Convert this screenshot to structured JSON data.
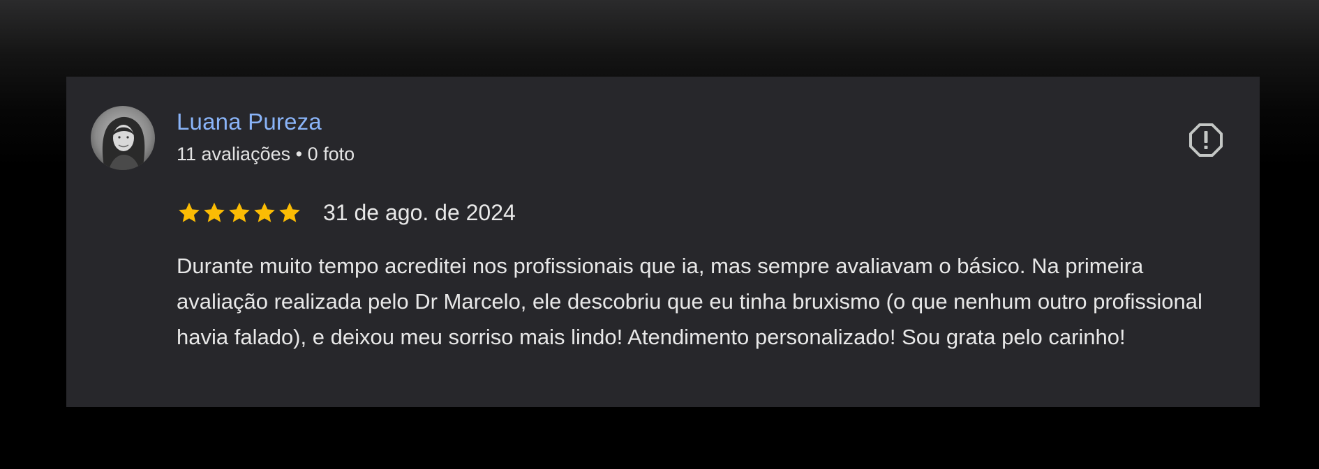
{
  "review": {
    "reviewer_name": "Luana Pureza",
    "reviewer_meta": "11 avaliações • 0 foto",
    "rating": 5,
    "rating_max": 5,
    "date": "31 de ago. de 2024",
    "text": "Durante muito tempo acreditei nos profissionais que ia, mas sempre avaliavam o básico. Na primeira avaliação realizada pelo Dr Marcelo, ele descobriu que eu tinha bruxismo (o que nenhum outro profissional havia falado), e deixou meu sorriso mais lindo! Atendimento personalizado! Sou grata pelo carinho!"
  },
  "icons": {
    "avatar": "avatar-photo",
    "report": "report-icon",
    "star": "star-icon"
  },
  "colors": {
    "card_background": "#27272b",
    "reviewer_name": "#8ab4f8",
    "star": "#fbbc04",
    "text": "#e8e8e8",
    "icon": "#c4c7c5"
  }
}
